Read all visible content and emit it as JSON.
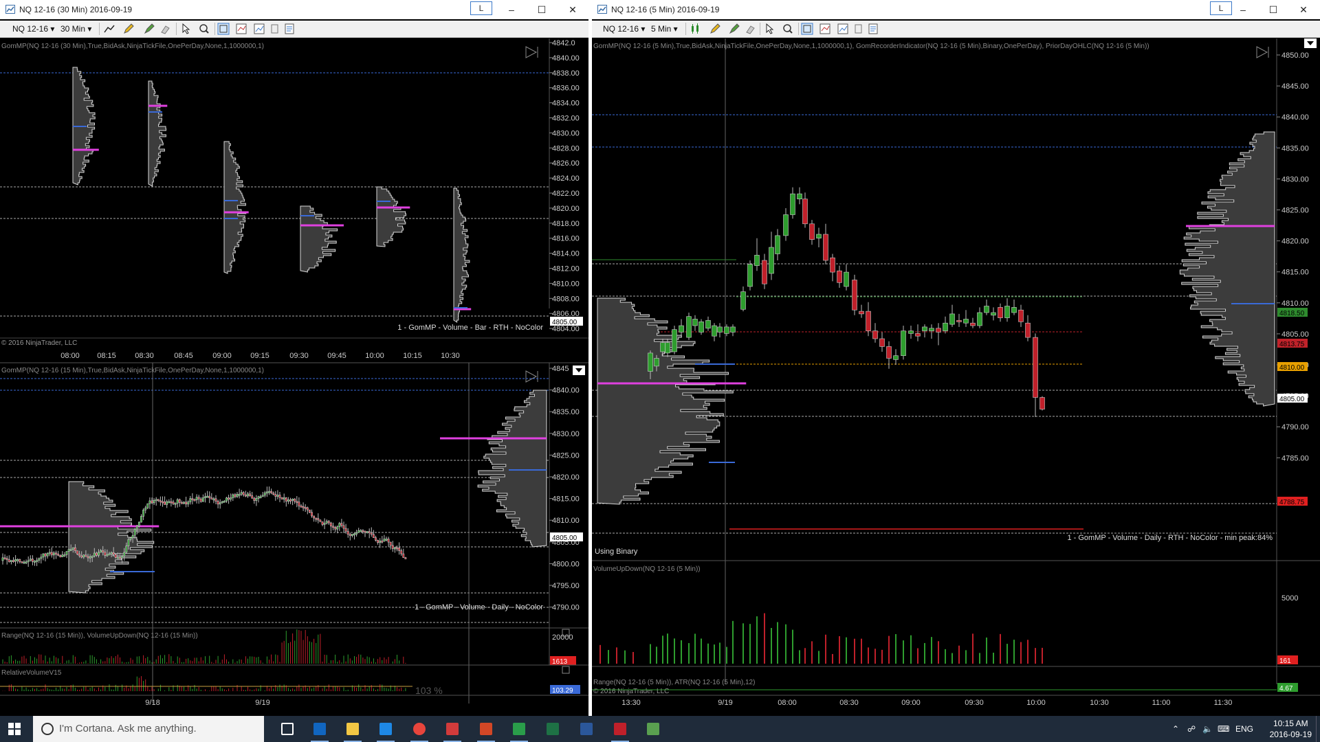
{
  "left_window": {
    "title": "NQ 12-16 (30 Min)  2016-09-19",
    "lbtn": "L",
    "toolbar": {
      "instrument": "NQ 12-16",
      "interval": "30 Min"
    },
    "panels": [
      {
        "header": "GomMP(NQ 12-16 (30 Min),True,BidAsk,NinjaTickFile,OnePerDay,None,1,1000000,1)",
        "footer": "1 - GomMP  - Volume - Bar - RTH - NoColor",
        "copyright": "© 2016 NinjaTrader, LLC",
        "y_ticks": [
          "4842.0",
          "4840.00",
          "4838.00",
          "4836.00",
          "4834.00",
          "4832.00",
          "4830.00",
          "4828.00",
          "4826.00",
          "4824.00",
          "4822.00",
          "4820.00",
          "4818.00",
          "4816.00",
          "4814.00",
          "4812.00",
          "4810.00",
          "4808.00",
          "4806.00",
          "4804.00"
        ],
        "price_marker": "4805.00",
        "x_ticks": [
          "08:00",
          "08:15",
          "08:30",
          "08:45",
          "09:00",
          "09:15",
          "09:30",
          "09:45",
          "10:00",
          "10:15",
          "10:30"
        ]
      },
      {
        "header": "GomMP(NQ 12-16 (15 Min),True,BidAsk,NinjaTickFile,OnePerDay,None,1,1000000,1)",
        "footer": "1 - GomMP  - Volume - Daily - NoColor",
        "y_ticks": [
          "4845",
          "4840.00",
          "4835.00",
          "4830.00",
          "4825.00",
          "4820.00",
          "4815.00",
          "4810.00",
          "4805.00",
          "4800.00",
          "4795.00",
          "4790.00"
        ],
        "price_marker": "4805.00",
        "x_ticks": [
          "9/18",
          "9/19"
        ]
      },
      {
        "header": "Range(NQ 12-16 (15 Min)), VolumeUpDown(NQ 12-16 (15 Min))",
        "tick": "20000",
        "marker": "1613"
      },
      {
        "header": "RelativeVolumeV15",
        "percent": "103 %",
        "marker": "103.29"
      }
    ]
  },
  "right_window": {
    "title": "NQ 12-16 (5 Min)  2016-09-19",
    "lbtn": "L",
    "toolbar": {
      "instrument": "NQ 12-16",
      "interval": "5 Min"
    },
    "main": {
      "header": "GomMP(NQ 12-16 (5 Min),True,BidAsk,NinjaTickFile,OnePerDay,None,1,1000000,1), GomRecorderIndicator(NQ 12-16 (5 Min),Binary,OnePerDay), PriorDayOHLC(NQ 12-16 (5 Min))",
      "y_ticks": [
        "4850.00",
        "4845.00",
        "4840.00",
        "4835.00",
        "4830.00",
        "4825.00",
        "4820.00",
        "4815.00",
        "4810.00",
        "4805.00",
        "4800.00",
        "4795.00",
        "4790.00",
        "4785.00"
      ],
      "markers": [
        {
          "label": "4818.50",
          "color": "#2e8b2e"
        },
        {
          "label": "4813.75",
          "color": "#c0222a"
        },
        {
          "label": "4810.00",
          "color": "#e8a000"
        },
        {
          "label": "4805.00",
          "color": "#ffffff"
        },
        {
          "label": "4788.75",
          "color": "#e02020"
        }
      ],
      "status_left": "Using Binary",
      "footer": "1 - GomMP  - Volume - Daily - RTH - NoColor - min peak:84%"
    },
    "volume_panel": {
      "header": "VolumeUpDown(NQ 12-16 (5 Min))",
      "tick": "5000",
      "marker": "161"
    },
    "range_panel": {
      "header": "Range(NQ 12-16 (5 Min)), ATR(NQ 12-16 (5 Min),12)",
      "copyright": "© 2016 NinjaTrader, LLC",
      "marker": "4.67"
    },
    "x_ticks": [
      "13:30",
      "9/19",
      "08:00",
      "08:30",
      "09:00",
      "09:30",
      "10:00",
      "10:30",
      "11:00",
      "11:30"
    ]
  },
  "taskbar": {
    "search_placeholder": "I'm Cortana. Ask me anything.",
    "lang": "ENG",
    "time": "10:15 AM",
    "date": "2016-09-19",
    "apps": [
      "task-view-icon",
      "outlook-icon",
      "file-explorer-icon",
      "edge-icon",
      "chrome-icon",
      "ninjatrader-icon",
      "powerpoint-icon",
      "tws-icon",
      "excel-icon",
      "word-icon",
      "acrobat-icon",
      "app-icon"
    ]
  }
}
